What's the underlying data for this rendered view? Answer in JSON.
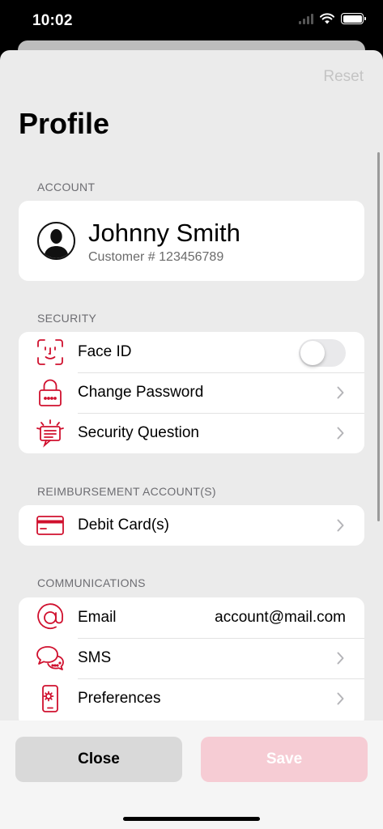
{
  "status_bar": {
    "time": "10:02"
  },
  "header": {
    "reset_label": "Reset",
    "title": "Profile"
  },
  "account": {
    "section_title": "ACCOUNT",
    "name": "Johnny Smith",
    "customer": "Customer # 123456789"
  },
  "security": {
    "section_title": "SECURITY",
    "items": [
      {
        "label": "Face ID",
        "icon": "face-id-icon",
        "toggle_on": false
      },
      {
        "label": "Change Password",
        "icon": "lock-icon"
      },
      {
        "label": "Security Question",
        "icon": "security-question-icon"
      }
    ]
  },
  "reimbursement": {
    "section_title": "REIMBURSEMENT ACCOUNT(S)",
    "items": [
      {
        "label": "Debit Card(s)",
        "icon": "credit-card-icon"
      }
    ]
  },
  "communications": {
    "section_title": "COMMUNICATIONS",
    "items": [
      {
        "label": "Email",
        "value": "account@mail.com",
        "icon": "at-sign-icon"
      },
      {
        "label": "SMS",
        "icon": "chat-bubbles-icon"
      },
      {
        "label": "Preferences",
        "icon": "phone-settings-icon"
      }
    ]
  },
  "footer": {
    "close_label": "Close",
    "save_label": "Save"
  },
  "colors": {
    "accent": "#d0102e",
    "save_disabled": "#f6ccd4",
    "close_bg": "#d9d9d9",
    "background": "#ebebeb"
  }
}
